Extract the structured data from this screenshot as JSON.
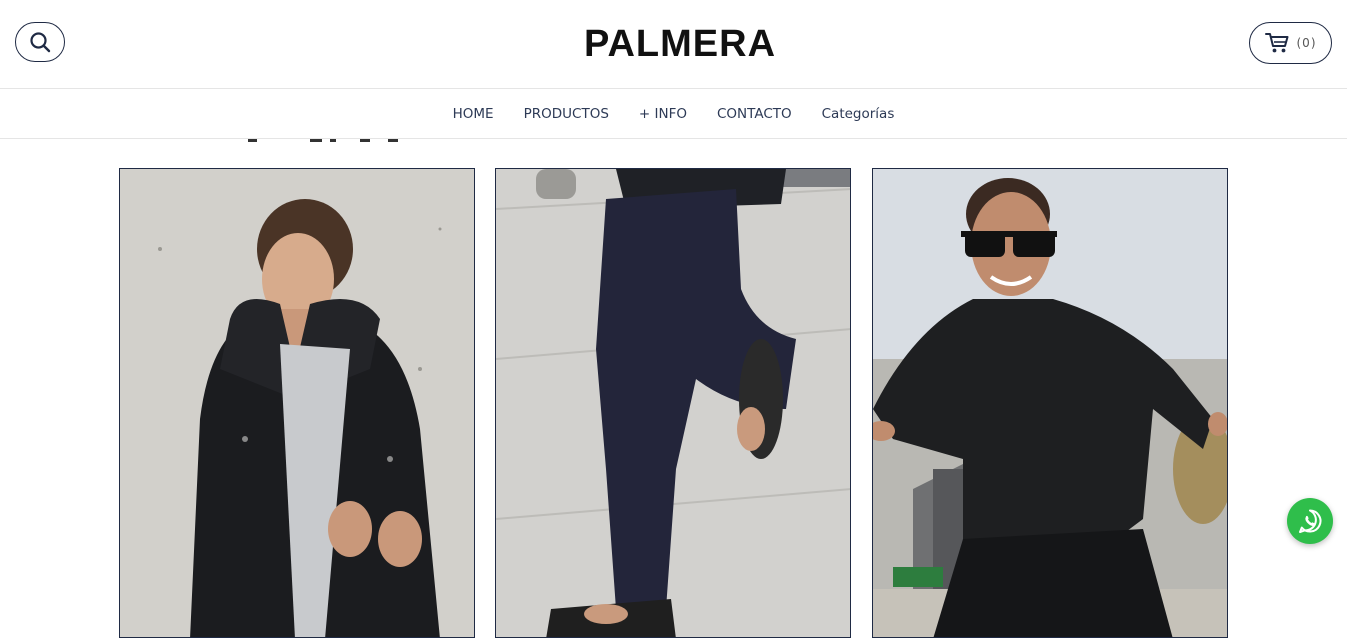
{
  "header": {
    "logo": "PALMERA",
    "cart_count": "(0)"
  },
  "nav": {
    "items": [
      "HOME",
      "PRODUCTOS",
      "+ INFO",
      "CONTACTO",
      "Categorías"
    ]
  },
  "icons": {
    "search": "search-icon",
    "cart": "cart-icon",
    "whatsapp": "whatsapp-icon"
  },
  "colors": {
    "accent": "#1f2a44",
    "whatsapp": "#2fbe4b"
  }
}
